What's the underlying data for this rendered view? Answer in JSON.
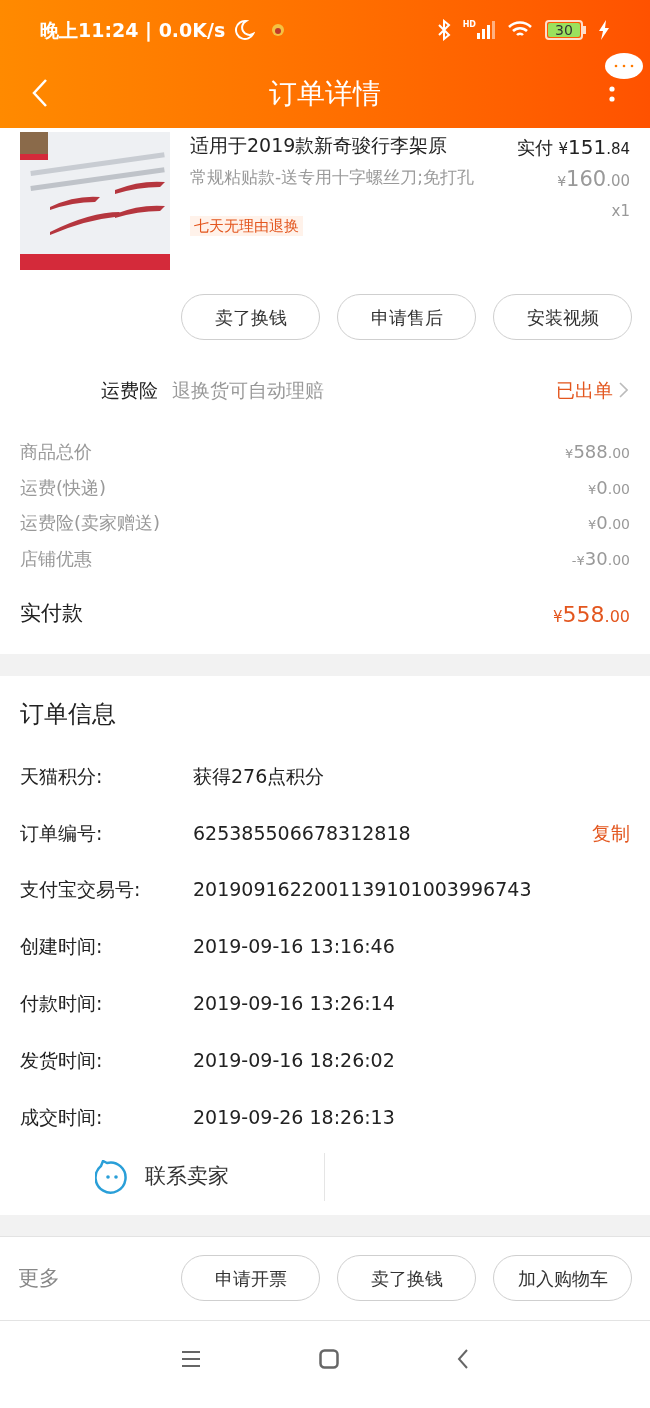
{
  "status_bar": {
    "time": "晚上11:24 | 0.0K/s",
    "signal_label": "HD",
    "battery": "30"
  },
  "header": {
    "title": "订单详情"
  },
  "product": {
    "title": "适用于2019款新奇骏行李架原",
    "price_label": "实付",
    "price": {
      "sign": "¥",
      "whole": "151",
      "fraction": ".84"
    },
    "sku": "常规粘贴款-送专用十字螺丝刀;免打孔",
    "original_price": {
      "sign": "¥",
      "whole": "160",
      "fraction": ".00"
    },
    "quantity": "x1",
    "tag": "七天无理由退换"
  },
  "item_buttons": [
    "卖了换钱",
    "申请售后",
    "安装视频"
  ],
  "insurance": {
    "label": "运费险",
    "description": "退换货可自动理赔",
    "status": "已出单"
  },
  "price_lines": [
    {
      "label": "商品总价",
      "amount": {
        "sign": "¥",
        "whole": "588",
        "fraction": ".00"
      }
    },
    {
      "label": "运费(快递)",
      "amount": {
        "sign": "¥",
        "whole": "0",
        "fraction": ".00"
      }
    },
    {
      "label": "运费险(卖家赠送)",
      "amount": {
        "sign": "¥",
        "whole": "0",
        "fraction": ".00"
      }
    },
    {
      "label": "店铺优惠",
      "amount": {
        "sign": "-¥",
        "whole": "30",
        "fraction": ".00"
      }
    }
  ],
  "total": {
    "label": "实付款",
    "amount": {
      "sign": "¥",
      "whole": "558",
      "fraction": ".00"
    }
  },
  "order_info": {
    "title": "订单信息",
    "rows": [
      {
        "label": "天猫积分:",
        "value": "获得276点积分"
      },
      {
        "label": "订单编号:",
        "value": "625385506678312818",
        "action": "复制"
      },
      {
        "label": "支付宝交易号:",
        "value": "2019091622001139101003996743"
      },
      {
        "label": "创建时间:",
        "value": "2019-09-16 13:16:46"
      },
      {
        "label": "付款时间:",
        "value": "2019-09-16 13:26:14"
      },
      {
        "label": "发货时间:",
        "value": "2019-09-16 18:26:02"
      },
      {
        "label": "成交时间:",
        "value": "2019-09-26 18:26:13"
      }
    ],
    "contact": "联系卖家"
  },
  "footer": {
    "more": "更多",
    "buttons": [
      "申请开票",
      "卖了换钱",
      "加入购物车"
    ]
  }
}
